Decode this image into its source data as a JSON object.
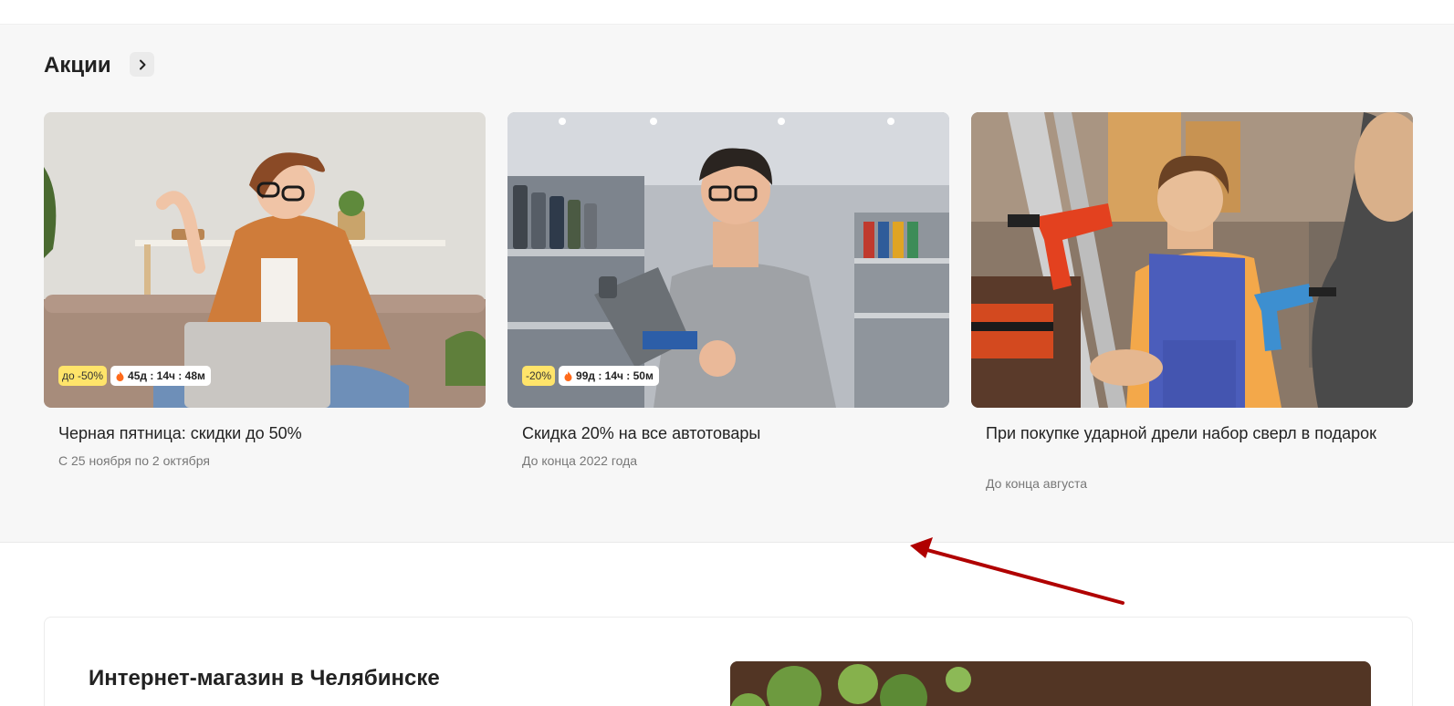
{
  "section": {
    "title": "Акции",
    "more_icon": "chevron-right-icon"
  },
  "promos": [
    {
      "title": "Черная пятница: скидки до 50%",
      "dates": "С 25 ноября по 2 октября",
      "discount_badge": "до -50%",
      "timer": "45д : 14ч : 48м",
      "image": "woman-with-laptop-photo"
    },
    {
      "title": "Скидка 20% на все автотовары",
      "dates": "До конца 2022 года",
      "discount_badge": "-20%",
      "timer": "99д : 14ч : 50м",
      "image": "man-with-motor-oil-photo"
    },
    {
      "title": "При покупке ударной дрели набор сверл в подарок",
      "dates": "До конца августа",
      "image": "worker-with-drills-photo"
    }
  ],
  "about": {
    "title": "Интернет-магазин в Челябинске"
  },
  "colors": {
    "section_bg": "#f7f7f7",
    "discount_badge": "#ffe46a",
    "fire_icon": "#ff6a1a",
    "annotation_arrow": "#b00000"
  }
}
